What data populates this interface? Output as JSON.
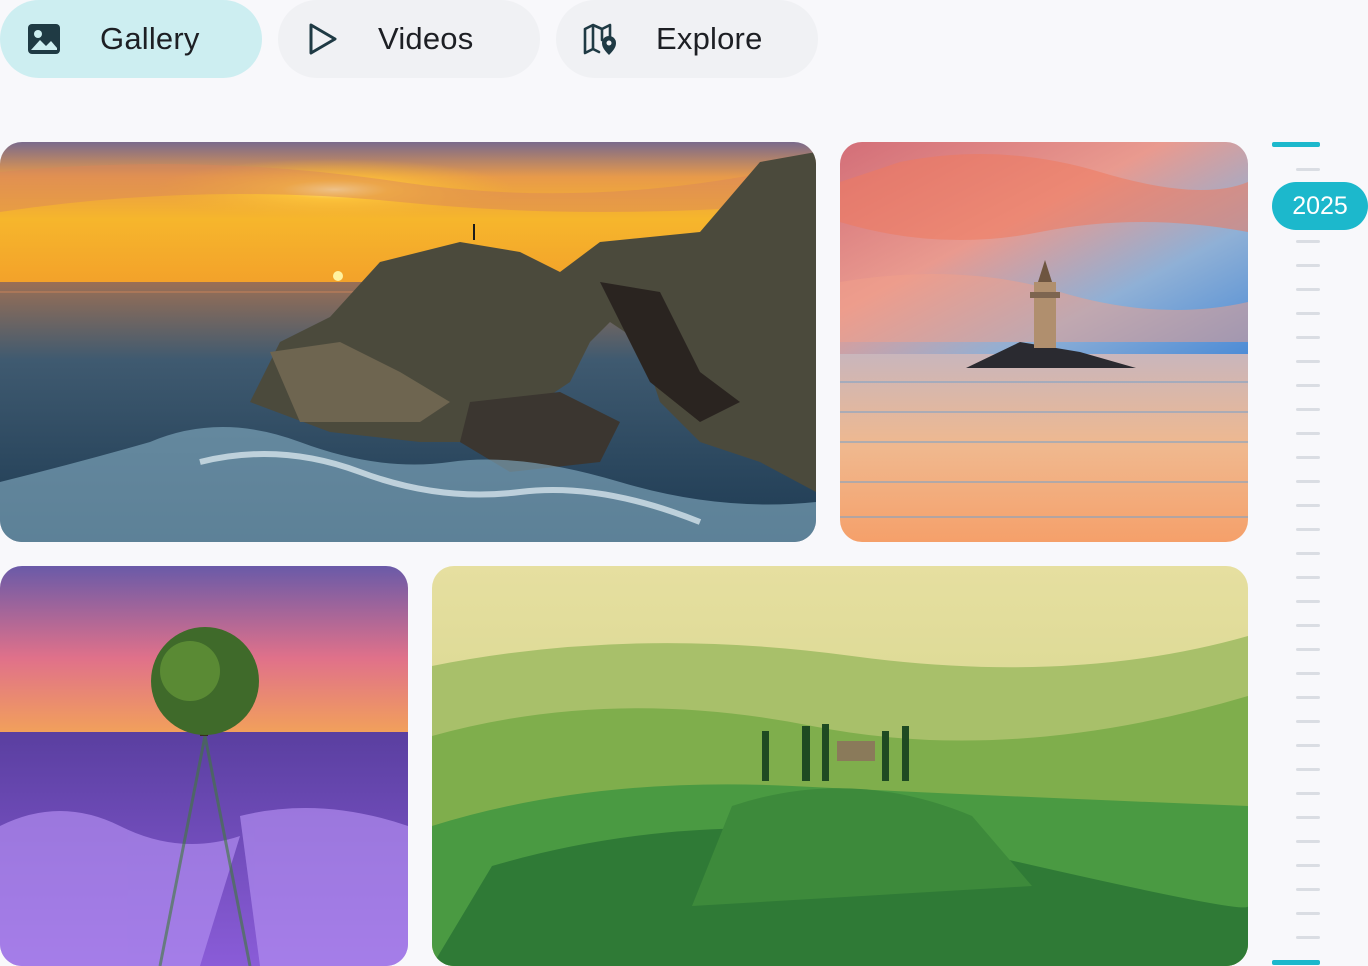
{
  "tabs": [
    {
      "label": "Gallery",
      "icon": "image-icon",
      "active": true
    },
    {
      "label": "Videos",
      "icon": "play-icon",
      "active": false
    },
    {
      "label": "Explore",
      "icon": "map-pin-icon",
      "active": false
    }
  ],
  "photos": [
    {
      "subject": "coastal-rock-arch-sunset"
    },
    {
      "subject": "lighthouse-islet-at-dawn"
    },
    {
      "subject": "lavender-field-with-tree"
    },
    {
      "subject": "rolling-green-hills"
    }
  ],
  "timeline": {
    "year": "2025"
  },
  "colors": {
    "accent": "#1cb8cc",
    "active_tab": "#cdeef1",
    "inactive_tab": "#f0f1f4",
    "background": "#f8f8fb"
  }
}
